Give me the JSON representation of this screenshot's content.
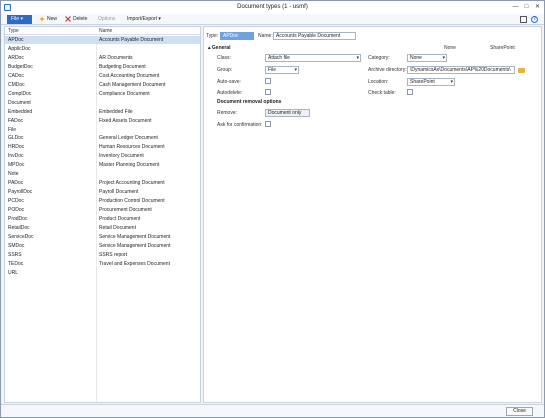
{
  "window": {
    "title": "Document types (1 - usmf)",
    "minimize": "—",
    "maximize": "□",
    "close": "✕"
  },
  "toolbar": {
    "file": "File",
    "new": "New",
    "delete": "Delete",
    "options": "Options",
    "import_export": "Import/Export"
  },
  "list": {
    "headers": {
      "type": "Type",
      "name": "Name"
    },
    "rows": [
      {
        "type": "APDoc",
        "name": "Accounts Payable Document"
      },
      {
        "type": "ApplicDoc",
        "name": ""
      },
      {
        "type": "ARDoc",
        "name": "AR Documents"
      },
      {
        "type": "BudgetDoc",
        "name": "Budgeting Document"
      },
      {
        "type": "CADoc",
        "name": "Cost Accounting Document"
      },
      {
        "type": "CMDoc",
        "name": "Cash Management Document"
      },
      {
        "type": "ComplDoc",
        "name": "Compliance Document"
      },
      {
        "type": "Document",
        "name": ""
      },
      {
        "type": "Embedded",
        "name": "Embedded File"
      },
      {
        "type": "FADoc",
        "name": "Fixed Assets Document"
      },
      {
        "type": "File",
        "name": ""
      },
      {
        "type": "GLDoc",
        "name": "General Ledger Document"
      },
      {
        "type": "HRDoc",
        "name": "Human Resources Document"
      },
      {
        "type": "InvDoc",
        "name": "Inventory Document"
      },
      {
        "type": "MPDoc",
        "name": "Master Planning Document"
      },
      {
        "type": "Note",
        "name": ""
      },
      {
        "type": "PADoc",
        "name": "Project Accounting Document"
      },
      {
        "type": "PayrollDoc",
        "name": "Payroll Document"
      },
      {
        "type": "PCDoc",
        "name": "Production Control Document"
      },
      {
        "type": "PODoc",
        "name": "Procurement Document"
      },
      {
        "type": "ProdDoc",
        "name": "Product Document"
      },
      {
        "type": "RetailDoc",
        "name": "Retail Document"
      },
      {
        "type": "ServiceDoc",
        "name": "Service Management Document"
      },
      {
        "type": "SMDoc",
        "name": "Service Management Document"
      },
      {
        "type": "SSRS",
        "name": "SSRS report"
      },
      {
        "type": "TEDoc",
        "name": "Travel and Expenses Document"
      },
      {
        "type": "URL",
        "name": ""
      }
    ]
  },
  "detail": {
    "type_label": "Type:",
    "type_value": "APDoc",
    "name_label": "Name:",
    "name_value": "Accounts Payable Document",
    "none_header": "None",
    "sharepoint_header": "SharePoint",
    "general_section": "General",
    "class_label": "Class:",
    "class_value": "Attach file",
    "group_label": "Group:",
    "group_value": "File",
    "autosave_label": "Auto-save:",
    "autodelete_label": "Autodelete:",
    "removal_section": "Document removal options",
    "remove_label": "Remove:",
    "remove_value": "Document only",
    "ask_label": "Ask for confirmation:",
    "category_label": "Category:",
    "category_value": "None",
    "archive_label": "Archive directory:",
    "archive_value": "\\DynamicsAx\\Documents\\AP%20Documents\\",
    "location_label": "Location:",
    "location_value": "SharePoint",
    "checktable_label": "Check table:"
  },
  "footer": {
    "close": "Close"
  }
}
